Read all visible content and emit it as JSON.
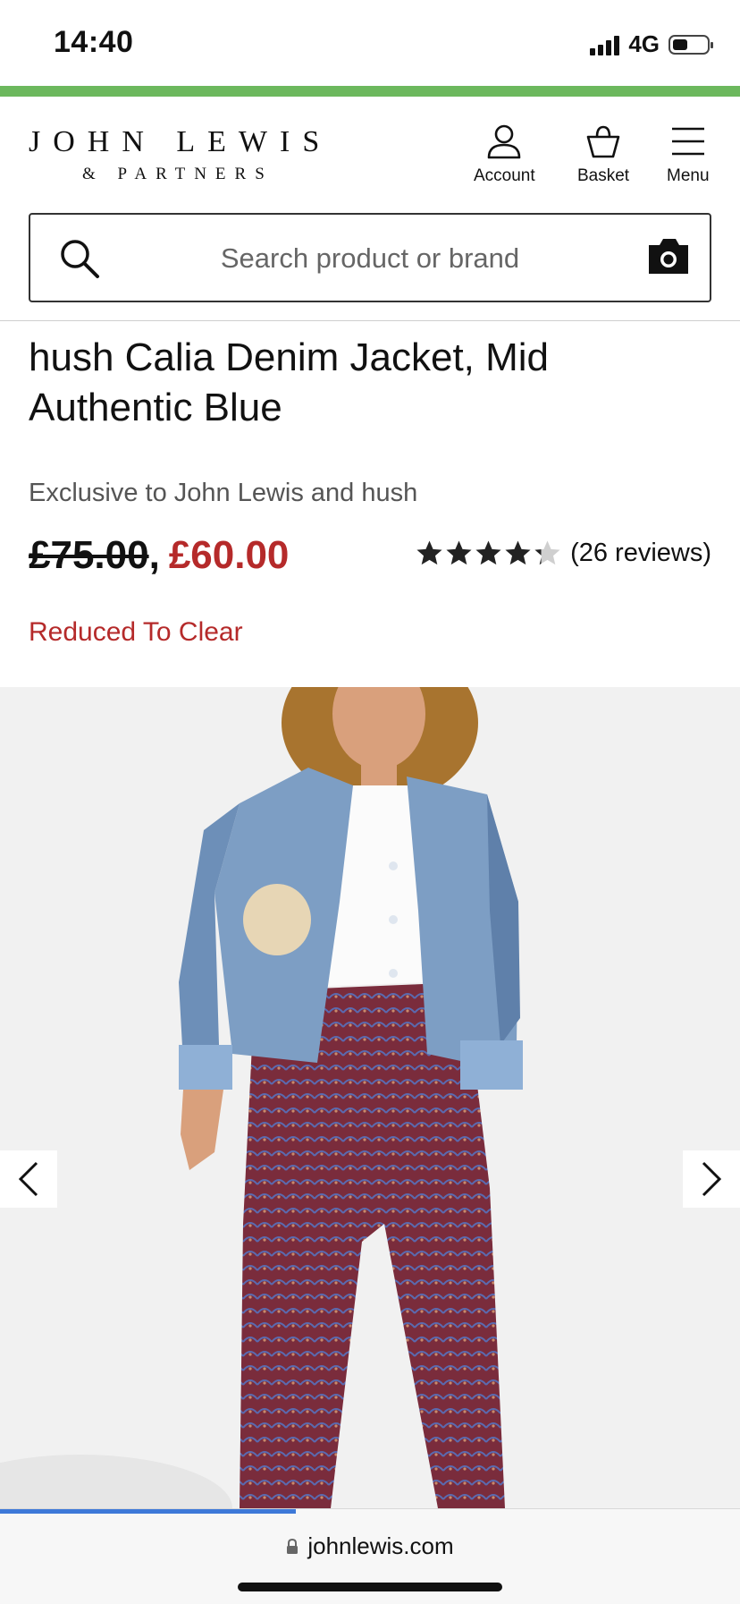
{
  "status_bar": {
    "time": "14:40",
    "network": "4G",
    "battery_level": 0.45
  },
  "header": {
    "logo_line1": "JOHN LEWIS",
    "logo_line2": "& PARTNERS",
    "account_label": "Account",
    "basket_label": "Basket",
    "menu_label": "Menu"
  },
  "search": {
    "placeholder": "Search product or brand",
    "value": ""
  },
  "product": {
    "title": "hush Calia Denim Jacket, Mid Authentic Blue",
    "exclusive_text": "Exclusive to John Lewis and hush",
    "price_old": "£75.00",
    "price_separator": ",",
    "price_new": "£60.00",
    "rating_value": 4.25,
    "rating_max": 5,
    "reviews_text": "(26 reviews)",
    "promo_text": "Reduced To Clear"
  },
  "browser": {
    "url": "johnlewis.com",
    "load_progress": 0.4
  },
  "colors": {
    "brand_green": "#6cb85d",
    "sale_red": "#b52a2a",
    "progress_blue": "#3d79d8"
  },
  "icons": [
    "account-icon",
    "basket-icon",
    "menu-icon",
    "search-icon",
    "camera-icon",
    "star-icon",
    "chevron-left-icon",
    "chevron-right-icon",
    "lock-icon"
  ]
}
